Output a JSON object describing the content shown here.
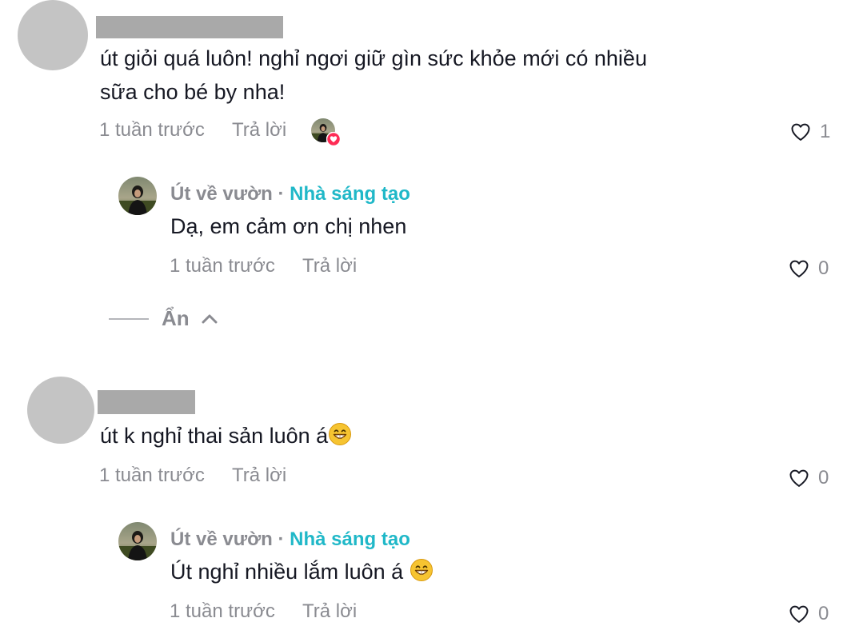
{
  "comments": [
    {
      "text_line1": "út giỏi quá luôn! nghỉ ngơi giữ gìn sức khỏe mới có nhiều",
      "text_line2": "sữa cho bé by nha!",
      "time": "1 tuần trước",
      "reply_label": "Trả lời",
      "likes": "1",
      "reply": {
        "author": "Út về vườn",
        "separator": "·",
        "badge": "Nhà sáng tạo",
        "text": "Dạ, em cảm ơn chị nhen",
        "time": "1 tuần trước",
        "reply_label": "Trả lời",
        "likes": "0"
      }
    },
    {
      "text": "út k nghỉ thai sản luôn á",
      "time": "1 tuần trước",
      "reply_label": "Trả lời",
      "likes": "0",
      "reply": {
        "author": "Út về vườn",
        "separator": "·",
        "badge": "Nhà sáng tạo",
        "text": "Út nghỉ nhiều lắm luôn á",
        "time": "1 tuần trước",
        "reply_label": "Trả lời",
        "likes": "0"
      }
    }
  ],
  "hide_replies_label": "Ẩn",
  "icons": {
    "like": "heart-outline-icon",
    "collapse": "chevron-up-icon",
    "creator_liked_badge": "heart-badge-icon",
    "emoji": "grinning-face-emoji-icon"
  },
  "colors": {
    "text": "#161823",
    "muted": "#8a8b91",
    "creator_badge": "#20b8c8",
    "heart_badge": "#fe2c55"
  }
}
